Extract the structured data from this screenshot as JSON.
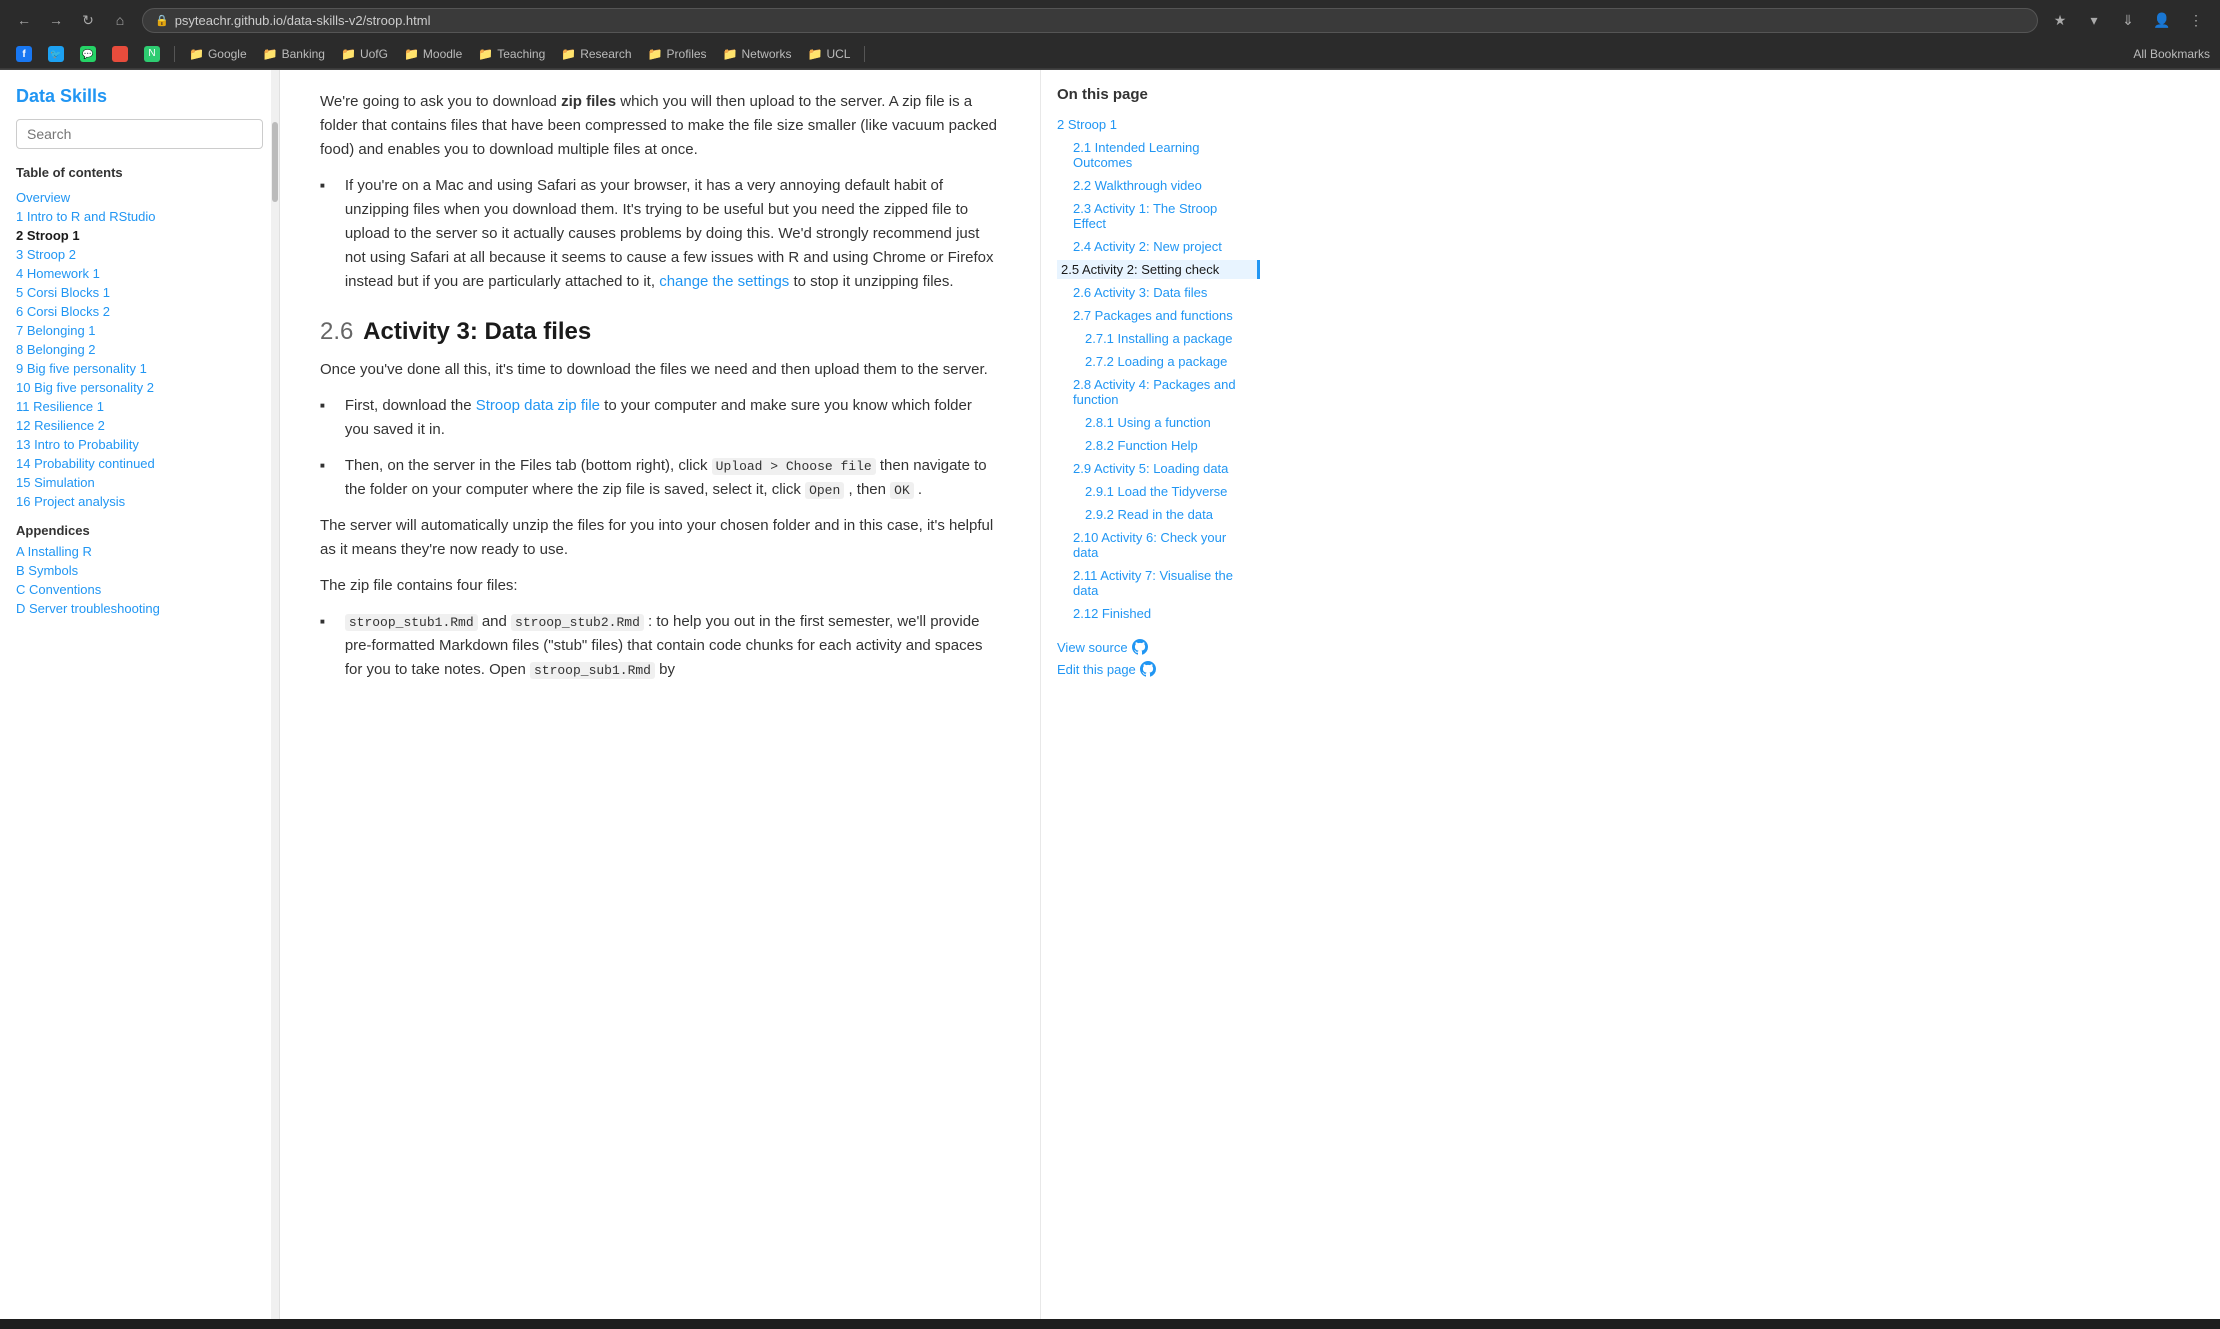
{
  "browser": {
    "url": "psyteachr.github.io/data-skills-v2/stroop.html",
    "nav_back": "←",
    "nav_forward": "→",
    "nav_refresh": "↺",
    "nav_home": "⌂",
    "favicon": "🔒"
  },
  "bookmarks": {
    "items": [
      {
        "label": "Google",
        "icon": "G"
      },
      {
        "label": "Banking",
        "icon": "🏦"
      },
      {
        "label": "UofG",
        "icon": "🎓"
      },
      {
        "label": "Moodle",
        "icon": "M"
      },
      {
        "label": "Teaching",
        "icon": "📚"
      },
      {
        "label": "Research",
        "icon": "🔬"
      },
      {
        "label": "Profiles",
        "icon": "👤"
      },
      {
        "label": "Networks",
        "icon": "🌐"
      },
      {
        "label": "UCL",
        "icon": "U"
      }
    ],
    "all_bookmarks_label": "All Bookmarks"
  },
  "sidebar": {
    "title": "Data Skills",
    "search_placeholder": "Search",
    "toc_header": "Table of contents",
    "toc_items": [
      {
        "label": "Overview",
        "active": false,
        "num": ""
      },
      {
        "label": "1 Intro to R and RStudio",
        "active": false,
        "num": "1"
      },
      {
        "label": "2 Stroop 1",
        "active": true,
        "num": "2"
      },
      {
        "label": "3 Stroop 2",
        "active": false,
        "num": "3"
      },
      {
        "label": "4 Homework 1",
        "active": false,
        "num": "4"
      },
      {
        "label": "5 Corsi Blocks 1",
        "active": false,
        "num": "5"
      },
      {
        "label": "6 Corsi Blocks 2",
        "active": false,
        "num": "6"
      },
      {
        "label": "7 Belonging 1",
        "active": false,
        "num": "7"
      },
      {
        "label": "8 Belonging 2",
        "active": false,
        "num": "8"
      },
      {
        "label": "9 Big five personality 1",
        "active": false,
        "num": "9"
      },
      {
        "label": "10 Big five personality 2",
        "active": false,
        "num": "10"
      },
      {
        "label": "11 Resilience 1",
        "active": false,
        "num": "11"
      },
      {
        "label": "12 Resilience 2",
        "active": false,
        "num": "12"
      },
      {
        "label": "13 Intro to Probability",
        "active": false,
        "num": "13"
      },
      {
        "label": "14 Probability continued",
        "active": false,
        "num": "14"
      },
      {
        "label": "15 Simulation",
        "active": false,
        "num": "15"
      },
      {
        "label": "16 Project analysis",
        "active": false,
        "num": "16"
      }
    ],
    "appendices_header": "Appendices",
    "appendices": [
      {
        "label": "A Installing R"
      },
      {
        "label": "B Symbols"
      },
      {
        "label": "C Conventions"
      },
      {
        "label": "D Server troubleshooting"
      }
    ]
  },
  "main": {
    "intro_para1": "We're going to ask you to download ",
    "zip_files_bold": "zip files",
    "intro_para1_cont": " which you will then upload to the server. A zip file is a folder that contains files that have been compressed to make the file size smaller (like vacuum packed food) and enables you to download multiple files at once.",
    "bullet1": "If you're on a Mac and using Safari as your browser, it has a very annoying default habit of unzipping files when you download them. It's trying to be useful but you need the zipped file to upload to the server so it actually causes problems by doing this. We'd strongly recommend just not using Safari at all because it seems to cause a few issues with R and using Chrome or Firefox instead but if you are particularly attached to it, ",
    "bullet1_link": "change the settings",
    "bullet1_cont": " to stop it unzipping files.",
    "section_num": "2.6",
    "section_title": "Activity 3: Data files",
    "section_para1": "Once you've done all this, it's time to download the files we need and then upload them to the server.",
    "bullet2_pre": "First, download the ",
    "bullet2_link": "Stroop data zip file",
    "bullet2_cont": " to your computer and make sure you know which folder you saved it in.",
    "bullet3_pre": "Then, on the server in the Files tab (bottom right), click ",
    "bullet3_code1": "Upload > Choose file",
    "bullet3_mid": " then navigate to the folder on your computer where the zip file is saved, select it, click ",
    "bullet3_code2": "Open",
    "bullet3_mid2": " , then ",
    "bullet3_code3": "OK",
    "bullet3_end": ".",
    "server_para1": "The server will automatically unzip the files for you into your chosen folder and in this case, it's helpful as it means they're now ready to use.",
    "zip_para": "The zip file contains four files:",
    "bullet4_code1": "stroop_stub1.Rmd",
    "bullet4_and": " and ",
    "bullet4_code2": "stroop_stub2.Rmd",
    "bullet4_cont": ": to help you out in the first semester, we'll provide pre-formatted Markdown files (\"stub\" files) that contain code chunks for each activity and spaces for you to take notes. Open ",
    "bullet4_code3": "stroop_sub1.Rmd",
    "bullet4_end": " by"
  },
  "right_sidebar": {
    "title": "On this page",
    "items": [
      {
        "label": "2 Stroop 1",
        "level": 0,
        "active": false
      },
      {
        "label": "2.1 Intended Learning Outcomes",
        "level": 1,
        "active": false
      },
      {
        "label": "2.2 Walkthrough video",
        "level": 1,
        "active": false
      },
      {
        "label": "2.3 Activity 1: The Stroop Effect",
        "level": 1,
        "active": false
      },
      {
        "label": "2.4 Activity 2: New project",
        "level": 1,
        "active": false
      },
      {
        "label": "2.5 Activity 2: Setting check",
        "level": 1,
        "active": true
      },
      {
        "label": "2.6 Activity 3: Data files",
        "level": 1,
        "active": false
      },
      {
        "label": "2.7 Packages and functions",
        "level": 1,
        "active": false
      },
      {
        "label": "2.7.1 Installing a package",
        "level": 2,
        "active": false
      },
      {
        "label": "2.7.2 Loading a package",
        "level": 2,
        "active": false
      },
      {
        "label": "2.8 Activity 4: Packages and function",
        "level": 1,
        "active": false
      },
      {
        "label": "2.8.1 Using a function",
        "level": 2,
        "active": false
      },
      {
        "label": "2.8.2 Function Help",
        "level": 2,
        "active": false
      },
      {
        "label": "2.9 Activity 5: Loading data",
        "level": 1,
        "active": false
      },
      {
        "label": "2.9.1 Load the Tidyverse",
        "level": 2,
        "active": false
      },
      {
        "label": "2.9.2 Read in the data",
        "level": 2,
        "active": false
      },
      {
        "label": "2.10 Activity 6: Check your data",
        "level": 1,
        "active": false
      },
      {
        "label": "2.11 Activity 7: Visualise the data",
        "level": 1,
        "active": false
      },
      {
        "label": "2.12 Finished",
        "level": 1,
        "active": false
      }
    ],
    "view_source": "View source",
    "edit_page": "Edit this page"
  }
}
